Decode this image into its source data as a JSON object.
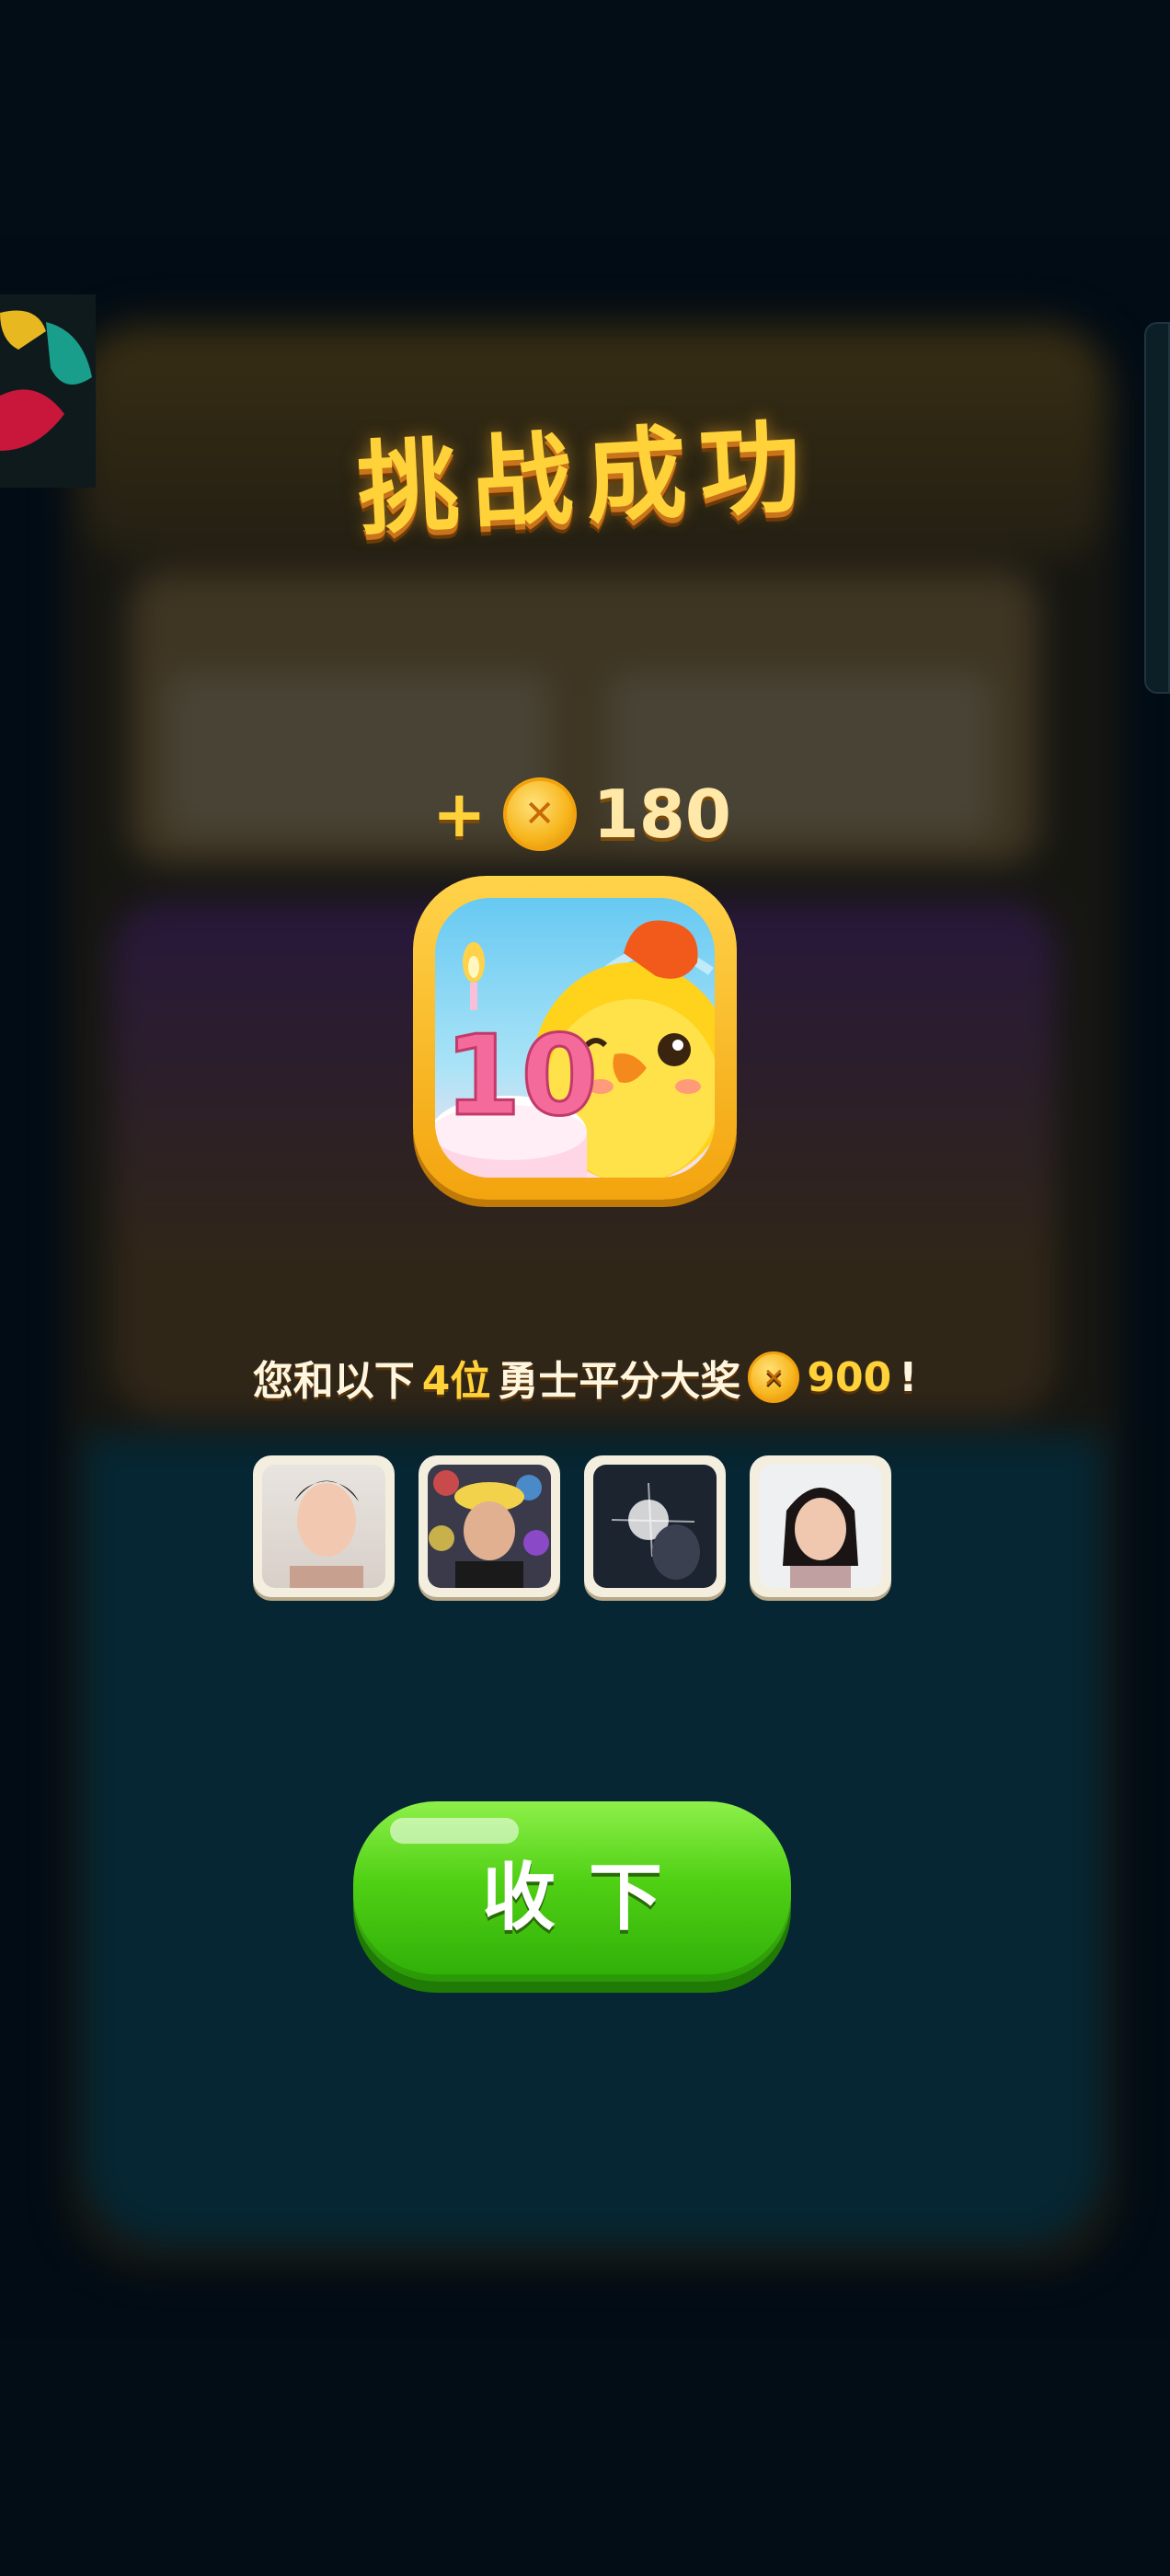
{
  "title": "挑战成功",
  "reward": {
    "plus": "+",
    "amount": "180",
    "coin_icon": "coin-icon"
  },
  "app_icon": {
    "number": "10"
  },
  "share": {
    "prefix": "您和以下",
    "count": "4位",
    "suffix": "勇士平分大奖",
    "prize": "900",
    "exclaim": "!"
  },
  "avatars": [
    {
      "name": "avatar-1"
    },
    {
      "name": "avatar-2"
    },
    {
      "name": "avatar-3"
    },
    {
      "name": "avatar-4"
    }
  ],
  "button": {
    "label": "收下"
  },
  "colors": {
    "title": "#ffd23a",
    "button": "#4fd014",
    "highlight": "#ffd23a"
  }
}
